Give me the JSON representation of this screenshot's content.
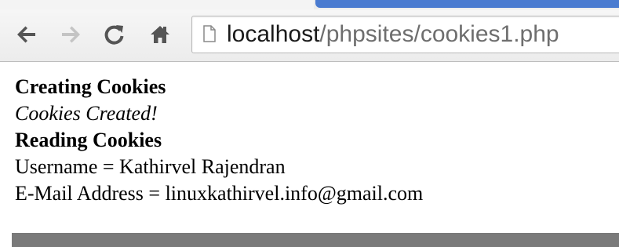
{
  "tab": {
    "title": "localhost/phpsites/cookies1.php"
  },
  "toolbar": {
    "back_icon": "arrow-left-icon",
    "forward_icon": "arrow-right-icon",
    "reload_icon": "reload-icon",
    "home_icon": "home-icon"
  },
  "address_bar": {
    "host": "localhost",
    "path": "/phpsites/cookies1.php",
    "icon": "page-icon"
  },
  "page": {
    "heading_creating": "Creating Cookies",
    "status_created": "Cookies Created!",
    "heading_reading": "Reading Cookies",
    "username_line": "Username = Kathirvel Rajendran",
    "email_line": "E-Mail Address = linuxkathirvel.info@gmail.com"
  },
  "colors": {
    "tab_accent": "#4a7bd0",
    "url_host": "#1a1a1a",
    "url_path": "#6e6e6e",
    "scrollbar": "#7a7a7a"
  }
}
